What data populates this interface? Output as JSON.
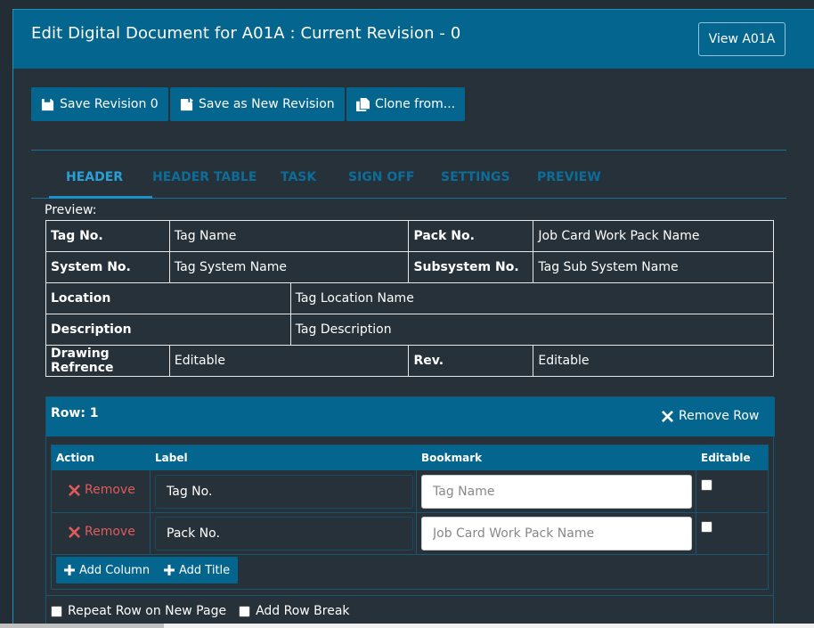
{
  "header": {
    "title": "Edit Digital Document for A01A : Current Revision - 0",
    "view_button": "View A01A"
  },
  "toolbar": {
    "save_revision": "Save Revision 0",
    "save_new": "Save as New Revision",
    "clone": "Clone from..."
  },
  "tabs": [
    "HEADER",
    "HEADER TABLE",
    "TASK",
    "SIGN OFF",
    "SETTINGS",
    "PREVIEW"
  ],
  "active_tab": "HEADER",
  "preview": {
    "label": "Preview:",
    "rows": [
      [
        "Tag No.",
        "Tag Name",
        "Pack No.",
        "Job Card Work Pack Name"
      ],
      [
        "System No.",
        "Tag System Name",
        "Subsystem No.",
        "Tag Sub System Name"
      ],
      [
        "Location",
        "Tag Location Name"
      ],
      [
        "Description",
        "Tag Description"
      ],
      [
        "Drawing Refrence",
        "Editable",
        "Rev.",
        "Editable"
      ]
    ]
  },
  "row_editor": {
    "title": "Row: 1",
    "remove_row": "Remove Row",
    "columns": [
      "Action",
      "Label",
      "Bookmark",
      "Editable"
    ],
    "items": [
      {
        "action": "Remove",
        "label": "Tag No.",
        "bookmark_placeholder": "Tag Name",
        "editable": false
      },
      {
        "action": "Remove",
        "label": "Pack No.",
        "bookmark_placeholder": "Job Card Work Pack Name",
        "editable": false
      }
    ],
    "add_column": "Add Column",
    "add_title": "Add Title",
    "repeat_row": "Repeat Row on New Page",
    "add_row_break": "Add Row Break"
  },
  "colors": {
    "header_bg": "#04668f",
    "page_bg": "#26313a",
    "tab_active": "#27a0d6",
    "remove_red": "#e05b5b"
  }
}
